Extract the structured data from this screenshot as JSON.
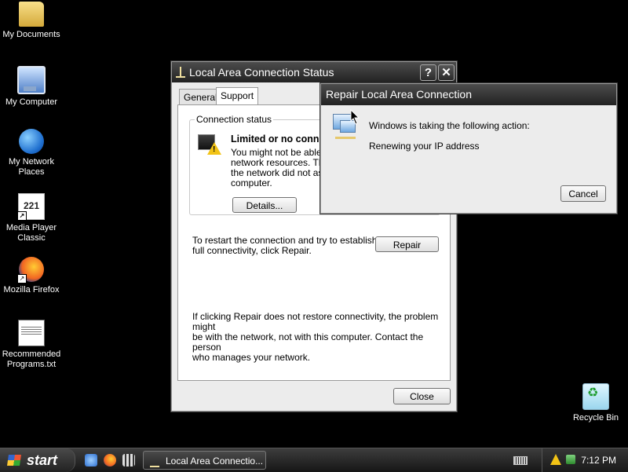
{
  "desktop": {
    "icons": [
      {
        "label": "My Documents",
        "icon": "my-documents-icon"
      },
      {
        "label": "My Computer",
        "icon": "my-computer-icon"
      },
      {
        "label": "My Network Places",
        "icon": "my-network-places-icon"
      },
      {
        "label": "Media Player Classic",
        "icon": "media-player-classic-icon",
        "glyph": "221"
      },
      {
        "label": "Mozilla Firefox",
        "icon": "firefox-icon"
      },
      {
        "label": "Recommended Programs.txt",
        "icon": "text-file-icon"
      },
      {
        "label": "Recycle Bin",
        "icon": "recycle-bin-icon"
      }
    ]
  },
  "status_window": {
    "title": "Local Area Connection Status",
    "help_button": "?",
    "close_button": "✕",
    "tabs": [
      {
        "label": "General",
        "active": false
      },
      {
        "label": "Support",
        "active": true
      }
    ],
    "connection_status_legend": "Connection status",
    "status_heading": "Limited or no conne",
    "status_lines": [
      "You might not be able to",
      "network resources. This",
      "the network did not assi",
      "computer."
    ],
    "details_button": "Details...",
    "repair_text_lines": [
      "To restart the connection and try to establish",
      "full connectivity, click Repair."
    ],
    "repair_button": "Repair",
    "note_lines": [
      "If clicking Repair does not restore connectivity, the problem might",
      "be with the network, not with this computer. Contact the person",
      "who manages your network."
    ],
    "close_label": "Close"
  },
  "repair_dialog": {
    "title": "Repair Local Area Connection",
    "action_text": "Windows is taking the following action:",
    "current_action": "Renewing your IP address",
    "cancel_button": "Cancel"
  },
  "taskbar": {
    "start_label": "start",
    "task_label": "Local Area Connectio...",
    "clock": "7:12 PM"
  }
}
